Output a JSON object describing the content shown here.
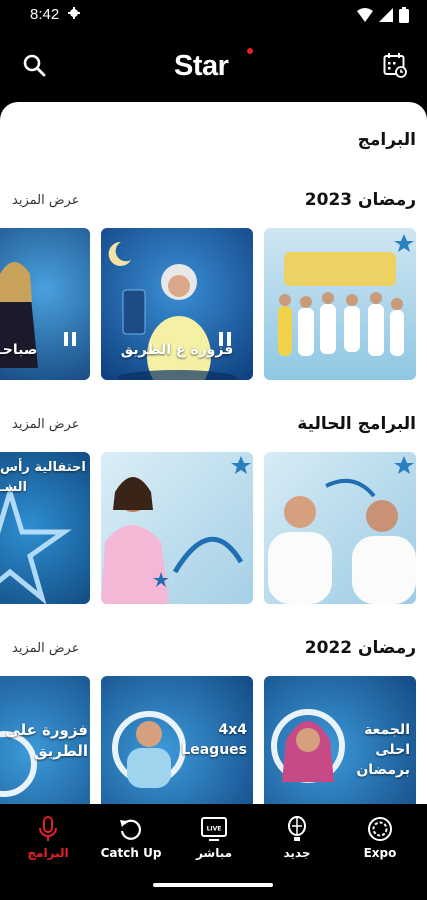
{
  "status": {
    "time": "8:42"
  },
  "header": {
    "logo": "Star",
    "brand_color": "#e4202a"
  },
  "page": {
    "title": "البرامج"
  },
  "sections": [
    {
      "title": "رمضان 2023",
      "more": "عرض المزيد",
      "cards": [
        {
          "caption": ""
        },
        {
          "caption": "فزورة ع الطريق"
        },
        {
          "caption": "صباحـ"
        }
      ]
    },
    {
      "title": "البرامج الحالية",
      "more": "عرض المزيد",
      "cards": [
        {
          "caption": ""
        },
        {
          "caption": ""
        },
        {
          "caption": "احتفالية رأس السـ"
        }
      ]
    },
    {
      "title": "رمضان 2022",
      "more": "عرض المزيد",
      "cards": [
        {
          "caption": "الجمعة احلى برمضان"
        },
        {
          "caption": "4x4 Leagues"
        },
        {
          "caption": "فزورة على الطريق"
        }
      ]
    }
  ],
  "nav": [
    {
      "label": "Expo",
      "icon": "expo-icon"
    },
    {
      "label": "جديد",
      "icon": "balloon-icon"
    },
    {
      "label": "مباشر",
      "icon": "live-tv-icon"
    },
    {
      "label": "Catch Up",
      "icon": "replay-icon"
    },
    {
      "label": "البرامج",
      "icon": "microphone-icon",
      "active": true
    }
  ]
}
